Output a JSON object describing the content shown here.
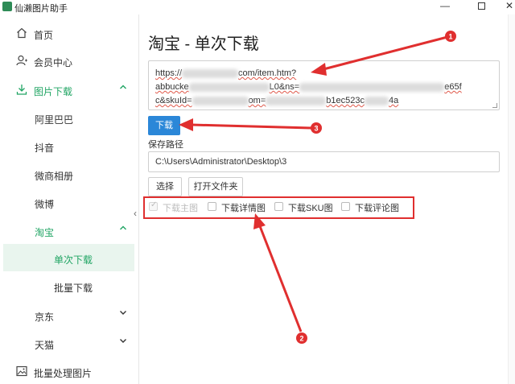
{
  "app": {
    "title": "仙濑图片助手",
    "window_controls": {
      "minimize": "—",
      "close": "✕"
    }
  },
  "sidebar": {
    "home": "首页",
    "member": "会员中心",
    "image_download": "图片下载",
    "alibaba": "阿里巴巴",
    "douyin": "抖音",
    "weishang": "微商相册",
    "weibo": "微博",
    "taobao": "淘宝",
    "single_download": "单次下载",
    "batch_download": "批量下载",
    "jd": "京东",
    "tmall": "天猫",
    "batch_process": "批量处理图片",
    "collapse": "‹"
  },
  "main": {
    "title": "淘宝 - 单次下载",
    "url_lines": [
      {
        "a": "https://",
        "b": "com/item.htm?"
      },
      {
        "a": "abbucke",
        "b": "L0&ns=",
        "c": "e65f"
      },
      {
        "a": "c&skuId=",
        "b": "om=",
        "c": "b1ec523c",
        "d": "4a"
      }
    ],
    "download_button": "下载",
    "save_path_label": "保存路径",
    "save_path_value": "C:\\Users\\Administrator\\Desktop\\3",
    "select_button": "选择",
    "open_folder_button": "打开文件夹",
    "options": [
      {
        "label": "下载主图",
        "checked": true,
        "disabled": true
      },
      {
        "label": "下载详情图",
        "checked": false,
        "disabled": false
      },
      {
        "label": "下载SKU图",
        "checked": false,
        "disabled": false
      },
      {
        "label": "下载评论图",
        "checked": false,
        "disabled": false
      }
    ]
  },
  "annotations": {
    "badges": [
      "1",
      "2",
      "3"
    ],
    "color": "#e02f2f"
  }
}
